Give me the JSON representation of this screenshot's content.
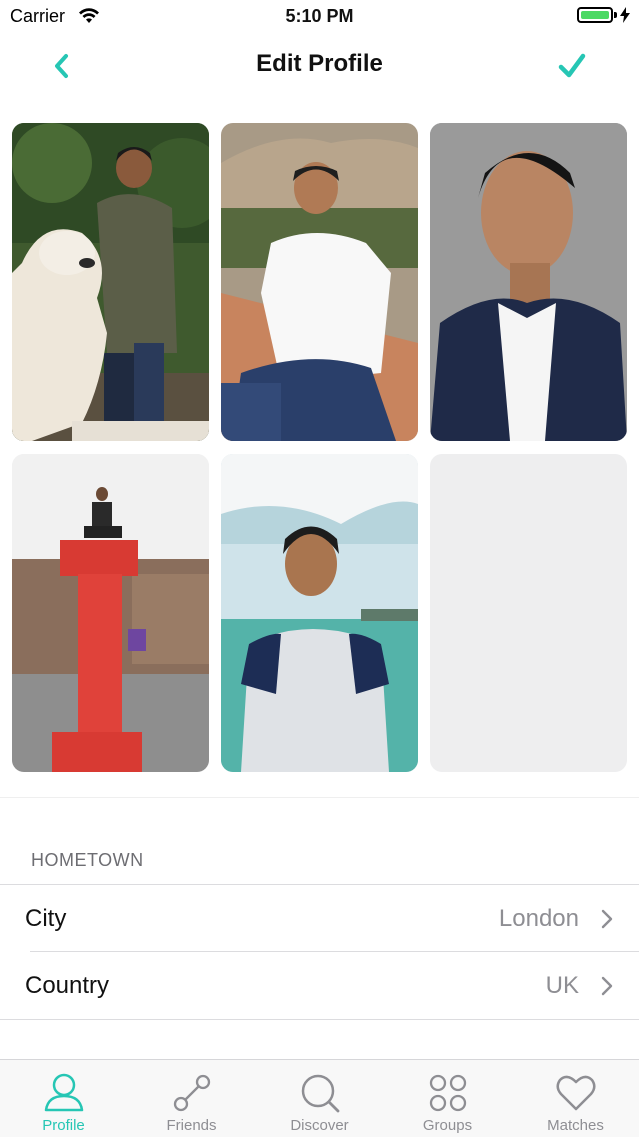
{
  "status_bar": {
    "carrier": "Carrier",
    "time": "5:10 PM",
    "battery_level": 1.0
  },
  "nav": {
    "title": "Edit Profile",
    "back_icon": "chevron-left-icon",
    "done_icon": "checkmark-icon"
  },
  "photos": [
    {
      "slot": 1,
      "filled": true,
      "subject": "man with white dog"
    },
    {
      "slot": 2,
      "filled": true,
      "subject": "man sitting on ledge"
    },
    {
      "slot": 3,
      "filled": true,
      "subject": "man in suit"
    },
    {
      "slot": 4,
      "filled": true,
      "subject": "man on red letter statue"
    },
    {
      "slot": 5,
      "filled": true,
      "subject": "man by water"
    },
    {
      "slot": 6,
      "filled": false,
      "subject": ""
    }
  ],
  "hometown": {
    "header": "HOMETOWN",
    "rows": [
      {
        "label": "City",
        "value": "London"
      },
      {
        "label": "Country",
        "value": "UK"
      }
    ]
  },
  "tabs": [
    {
      "label": "Profile",
      "icon": "person-icon",
      "active": true
    },
    {
      "label": "Friends",
      "icon": "connection-icon",
      "active": false
    },
    {
      "label": "Discover",
      "icon": "search-icon",
      "active": false
    },
    {
      "label": "Groups",
      "icon": "grid-circles-icon",
      "active": false
    },
    {
      "label": "Matches",
      "icon": "heart-icon",
      "active": false
    }
  ],
  "colors": {
    "accent": "#26c6b4",
    "tab_inactive": "#8e8e93",
    "secondary_text": "#8e8e93",
    "section_header": "#6d6d72",
    "battery": "#4cd964"
  }
}
